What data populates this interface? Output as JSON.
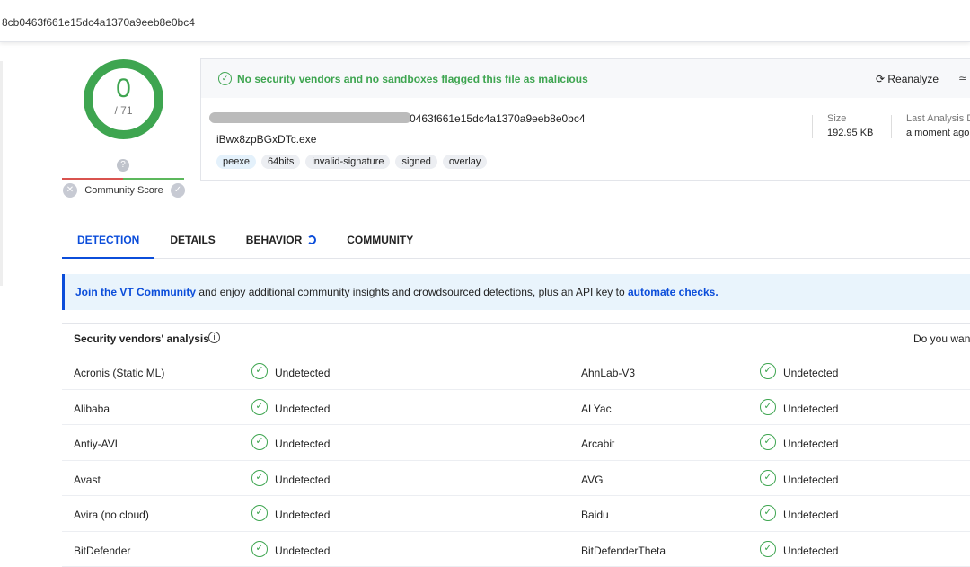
{
  "search": {
    "value": "8cb0463f661e15dc4a1370a9eeb8e0bc4"
  },
  "score": {
    "detections": "0",
    "total": "/ 71",
    "color": "#3ea550"
  },
  "community": {
    "label": "Community Score",
    "icon": "question-icon"
  },
  "summary": {
    "status": "No security vendors and no sandboxes flagged this file as malicious",
    "reanalyze": "Reanalyze",
    "hash_tail": "0463f661e15dc4a1370a9eeb8e0bc4",
    "filename": "iBwx8zpBGxDTc.exe",
    "tags": [
      "peexe",
      "64bits",
      "invalid-signature",
      "signed",
      "overlay"
    ],
    "size_label": "Size",
    "size_value": "192.95 KB",
    "last_label": "Last Analysis D",
    "last_value": "a moment ago"
  },
  "tabs": [
    "DETECTION",
    "DETAILS",
    "BEHAVIOR",
    "COMMUNITY"
  ],
  "banner": {
    "link1": "Join the VT Community",
    "text": " and enjoy additional community insights and crowdsourced detections, plus an API key to ",
    "link2": "automate checks."
  },
  "vendors": {
    "title": "Security vendors' analysis",
    "right": "Do you want",
    "rows": [
      [
        "Acronis (Static ML)",
        "Undetected",
        "AhnLab-V3",
        "Undetected"
      ],
      [
        "Alibaba",
        "Undetected",
        "ALYac",
        "Undetected"
      ],
      [
        "Antiy-AVL",
        "Undetected",
        "Arcabit",
        "Undetected"
      ],
      [
        "Avast",
        "Undetected",
        "AVG",
        "Undetected"
      ],
      [
        "Avira (no cloud)",
        "Undetected",
        "Baidu",
        "Undetected"
      ],
      [
        "BitDefender",
        "Undetected",
        "BitDefenderTheta",
        "Undetected"
      ]
    ]
  }
}
